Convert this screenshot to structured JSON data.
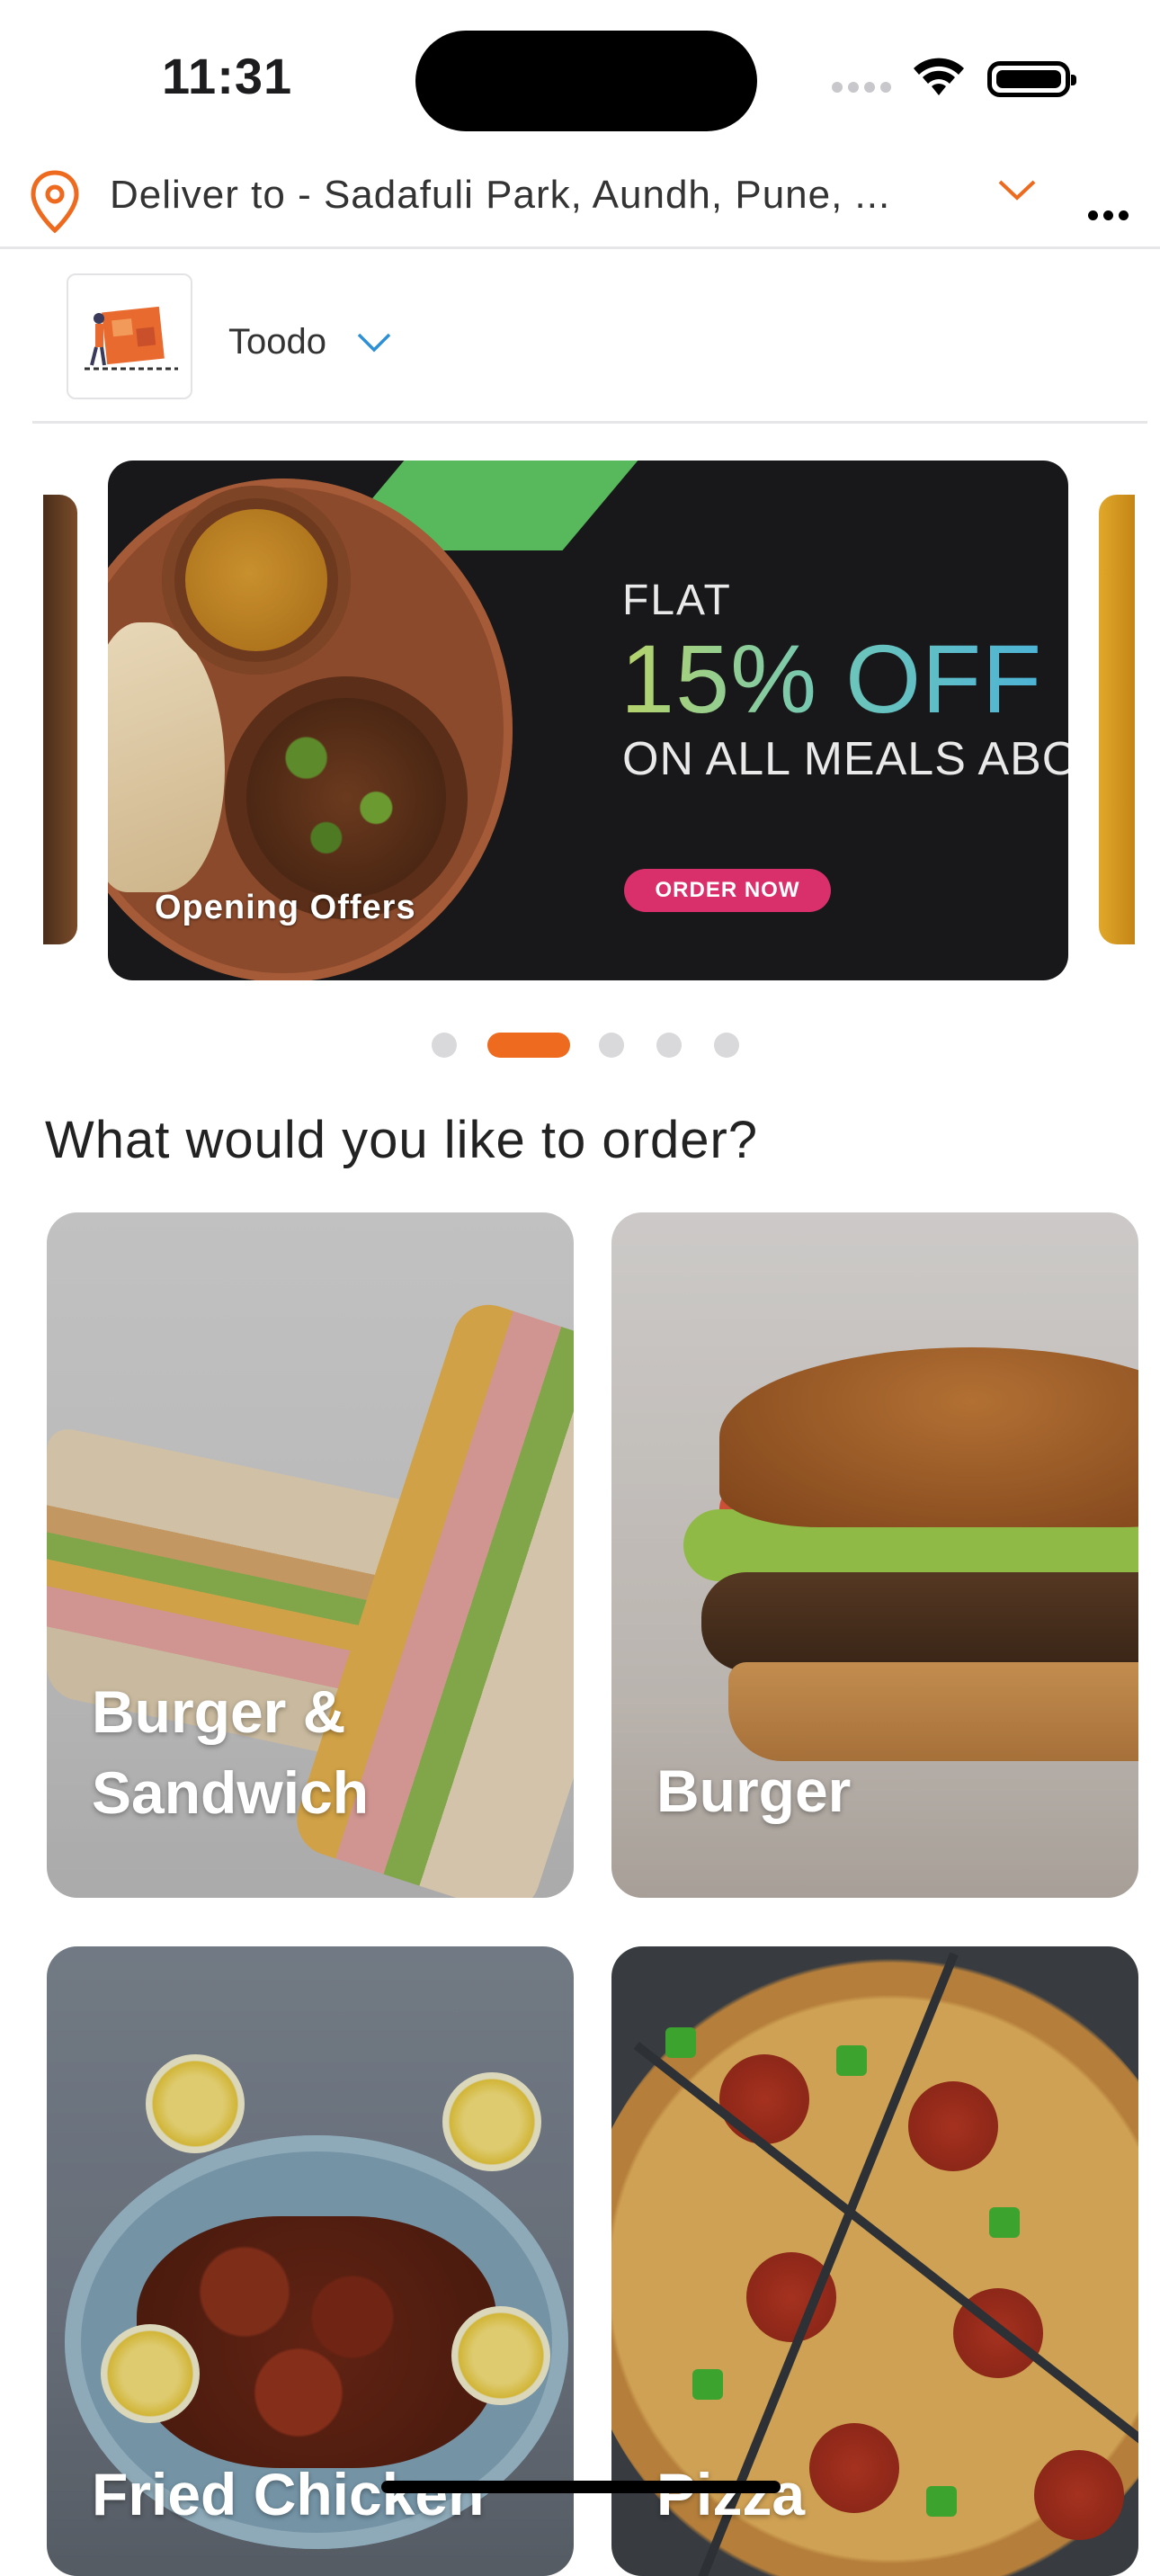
{
  "status_bar": {
    "time": "11:31"
  },
  "header": {
    "deliver_text": "Deliver to - Sadafuli Park, Aundh, Pune, ...",
    "accent_color": "#ee6a1f"
  },
  "store": {
    "name": "Toodo"
  },
  "carousel": {
    "active_index": 1,
    "slide_count": 5,
    "banner": {
      "flat": "FLAT",
      "offer": "15% OFF",
      "meals": "ON ALL MEALS ABOV",
      "cta": "ORDER NOW",
      "label": "Opening Offers"
    }
  },
  "section": {
    "title": "What would you like to order?"
  },
  "categories": [
    {
      "label_line1": "Burger &",
      "label_line2": "Sandwich"
    },
    {
      "label": "Burger"
    },
    {
      "label": "Fried Chicken"
    },
    {
      "label": "Pizza"
    }
  ]
}
